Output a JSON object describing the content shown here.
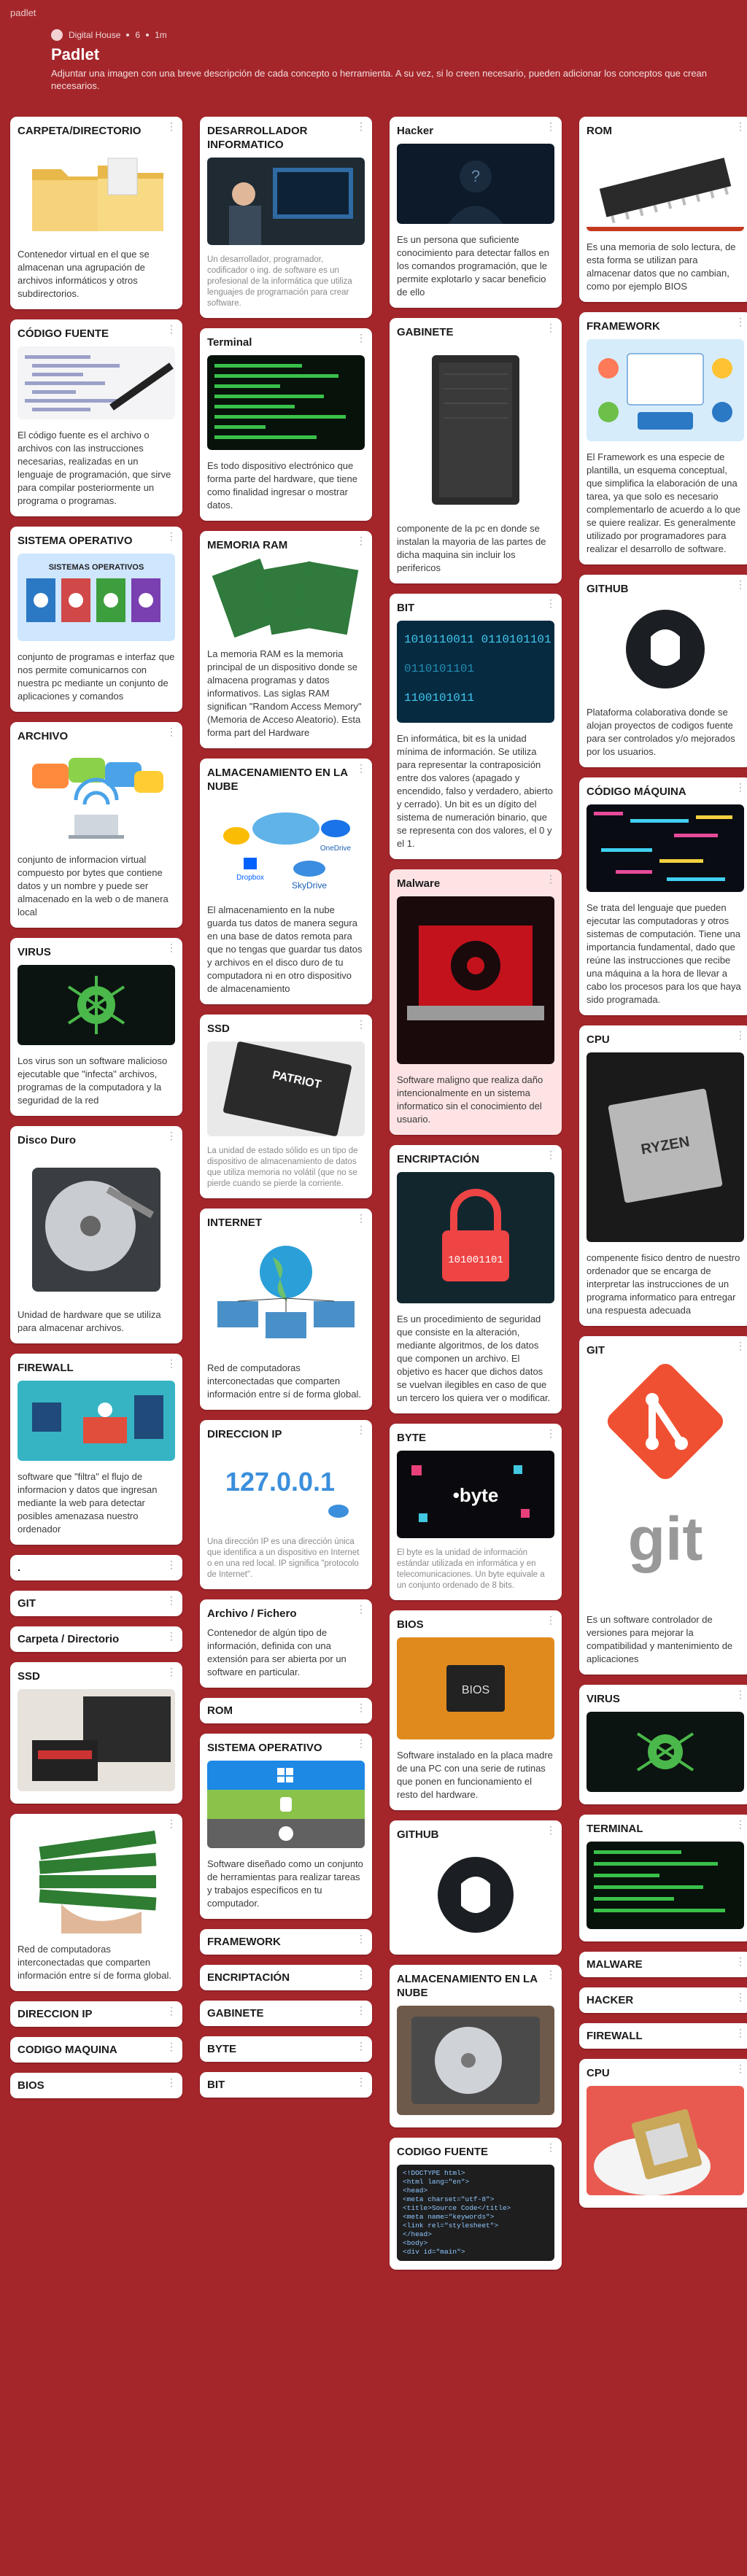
{
  "topbar": {
    "label": "padlet"
  },
  "header": {
    "author": "Digital House",
    "likes": "6",
    "time": "1m",
    "title": "Padlet",
    "description": "Adjuntar una imagen con una breve descripción de cada concepto o herramienta. A su vez, si lo creen necesario, pueden adicionar los conceptos que crean necesarios."
  },
  "col1": [
    {
      "title": "CARPETA/DIRECTORIO",
      "body": "Contenedor virtual en el que se almacenan una agrupación de archivos informáticos y otros subdirectorios."
    },
    {
      "title": "CÓDIGO FUENTE",
      "body": "El código fuente es el archivo o archivos con las instrucciones necesarias, realizadas en un lenguaje de programación, que sirve para compilar posteriormente un programa o programas."
    },
    {
      "title": "SISTEMA OPERATIVO",
      "image_caption": "SISTEMAS OPERATIVOS",
      "body": "conjunto de programas e interfaz que nos permite comunicarnos con nuestra pc mediante un conjunto de aplicaciones y comandos"
    },
    {
      "title": "ARCHIVO",
      "body": "conjunto de informacion virtual compuesto por bytes que contiene datos y un nombre y puede ser almacenado en la web o de manera local"
    },
    {
      "title": "VIRUS",
      "body": "Los virus son un software malicioso ejecutable que \"infecta\" archivos, programas de la computadora y la seguridad de la red"
    },
    {
      "title": "Disco Duro",
      "body": "Unidad de hardware que se utiliza para almacenar archivos."
    },
    {
      "title": "FIREWALL",
      "body": "software que \"filtra\" el flujo de informacion y datos que ingresan mediante la web para detectar posibles amenazasa nuestro ordenador"
    },
    {
      "title": "."
    },
    {
      "title": "GIT"
    },
    {
      "title": "Carpeta / Directorio"
    },
    {
      "title": "SSD"
    },
    {
      "title": "",
      "body": "Red de computadoras interconectadas que comparten información entre sí de forma global."
    },
    {
      "title": "DIRECCION IP"
    },
    {
      "title": "CODIGO MAQUINA"
    },
    {
      "title": "BIOS"
    }
  ],
  "col2": [
    {
      "title": "DESARROLLADOR INFORMATICO",
      "body": "Un desarrollador, programador, codificador o ing. de software es un profesional de la informática que utiliza lenguajes de programación para crear software."
    },
    {
      "title": "Terminal",
      "body": "Es todo dispositivo electrónico que forma parte del hardware, que tiene como finalidad ingresar o mostrar datos."
    },
    {
      "title": "MEMORIA RAM",
      "body": "La memoria RAM es la memoria principal de un dispositivo donde se almacena programas y datos informativos. Las siglas RAM significan \"Random Access Memory\" (Memoria de Acceso Aleatorio). Esta forma part del Hardware"
    },
    {
      "title": "ALMACENAMIENTO EN LA NUBE",
      "cloud_labels": [
        "OneDrive",
        "Dropbox",
        "SkyDrive"
      ],
      "body": "El almacenamiento en la nube guarda tus datos de manera segura en una base de datos remota para que no tengas que guardar tus datos y archivos en el disco duro de tu computadora ni en otro dispositivo de almacenamiento"
    },
    {
      "title": "SSD",
      "ssd_brand": "PATRIOT",
      "body": "La unidad de estado sólido es un tipo de dispositivo de almacenamiento de datos que utiliza memoria no volátil (que no se pierde cuando se pierde la corriente."
    },
    {
      "title": "INTERNET",
      "body": "Red de computadoras interconectadas que comparten información entre sí de forma global."
    },
    {
      "title": "DIRECCION IP",
      "ip_text": "127.0.0.1",
      "body": "Una dirección IP es una dirección única que identifica a un dispositivo en Internet o en una red local. IP significa \"protocolo de Internet\"."
    },
    {
      "title": "Archivo / Fichero",
      "body": "Contenedor de algún tipo de información, definida con una extensión para ser abierta por un software en particular."
    },
    {
      "title": "ROM"
    },
    {
      "title": "SISTEMA OPERATIVO",
      "body": "Software diseñado como un conjunto de herramientas para realizar tareas y trabajos específicos en tu computador."
    },
    {
      "title": "FRAMEWORK"
    },
    {
      "title": "ENCRIPTACIÓN"
    },
    {
      "title": "GABINETE"
    },
    {
      "title": "BYTE"
    },
    {
      "title": "BIT"
    }
  ],
  "col3": [
    {
      "title": "Hacker",
      "body": "Es un persona que suficiente conocimiento para detectar fallos en los comandos programación, que le permite explotarlo y sacar beneficio de ello"
    },
    {
      "title": "GABINETE",
      "body": "componente de la pc en donde se instalan la mayoria de las partes de dicha maquina sin incluir los perifericos"
    },
    {
      "title": "BIT",
      "binary_text": "1010110011 0110101101 1100101011 0011101101",
      "body": "En informática, bit es la unidad mínima de información. Se utiliza para representar la contraposición entre dos valores (apagado y encendido, falso y verdadero, abierto y cerrado). Un bit es un dígito del sistema de numeración binario, que se representa con dos valores, el 0 y el 1."
    },
    {
      "title": "Malware",
      "body": "Software maligno que realiza daño intencionalmente en un sistema informatico sin el conocimiento del usuario."
    },
    {
      "title": "ENCRIPTACIÓN",
      "lock_text": "101001101",
      "body": "Es un procedimiento de seguridad que consiste en la alteración, mediante algoritmos, de los datos que componen un archivo. El objetivo es hacer que dichos datos se vuelvan ilegibles en caso de que un tercero los quiera ver o modificar."
    },
    {
      "title": "BYTE",
      "image_label": "•byte",
      "body": "El byte es la unidad de información estándar utilizada en informática y en telecomunicaciones. Un byte equivale a un conjunto ordenado de 8 bits."
    },
    {
      "title": "BIOS",
      "chip_label": "BIOS",
      "body": "Software instalado en la placa madre de una PC con una serie de rutinas que ponen en funcionamiento el resto del hardware."
    },
    {
      "title": "GITHUB"
    },
    {
      "title": "ALMACENAMIENTO EN LA NUBE"
    },
    {
      "title": "CODIGO FUENTE",
      "code_lines": [
        "<!DOCTYPE html>",
        "<html lang=\"en\">",
        "<head>",
        "  <meta charset=\"utf-8\">",
        "  <title>Source Code</title>",
        "  <meta name=\"keywords\">",
        "  <link rel=\"stylesheet\">",
        "</head>",
        "<body>",
        "  <div id=\"main\">"
      ]
    }
  ],
  "col4": [
    {
      "title": "ROM",
      "body": "Es una memoria de solo lectura, de esta forma se utilizan para almacenar datos que no cambian, como por ejemplo BIOS"
    },
    {
      "title": "FRAMEWORK",
      "body": "El Framework es una especie de plantilla, un esquema conceptual, que simplifica la elaboración de una tarea, ya que solo es necesario complementarlo de acuerdo a lo que se quiere realizar. Es generalmente utilizado por programadores para realizar el desarrollo de software."
    },
    {
      "title": "GITHUB",
      "body": "Plataforma colaborativa donde se alojan proyectos de codigos fuente para ser controlados y/o mejorados por los usuarios."
    },
    {
      "title": "CÓDIGO MÁQUINA",
      "body": "Se trata del lenguaje que pueden ejecutar las computadoras y otros sistemas de computación. Tiene una importancia fundamental, dado que reúne las instrucciones que recibe una máquina a la hora de llevar a cabo los procesos para los que haya sido programada."
    },
    {
      "title": "CPU",
      "chip_label": "RYZEN",
      "body": "compenente fisico dentro de nuestro ordenador que se encarga de interpretar las instrucciones de un programa informatico para entregar una respuesta adecuada"
    },
    {
      "title": "GIT",
      "logo_text": "git",
      "body": "Es un software controlador de versiones para mejorar la compatibilidad y mantenimiento de aplicaciones"
    },
    {
      "title": "VIRUS"
    },
    {
      "title": "TERMINAL"
    },
    {
      "title": "MALWARE"
    },
    {
      "title": "HACKER"
    },
    {
      "title": "FIREWALL"
    },
    {
      "title": "CPU"
    }
  ],
  "menu_glyph": "⋮"
}
